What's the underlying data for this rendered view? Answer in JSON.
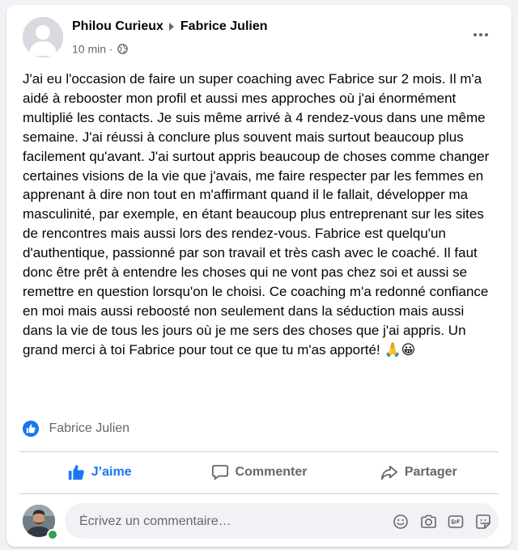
{
  "post": {
    "author": "Philou Curieux",
    "recipient": "Fabrice Julien",
    "time": "10 min",
    "separator": "·",
    "text": "J'ai eu l'occasion de faire un super coaching avec Fabrice sur 2 mois. Il m'a aidé à rebooster mon profil et aussi mes approches où j'ai énormément multiplié les contacts. Je suis même arrivé à 4 rendez-vous dans une même semaine. J'ai réussi à conclure plus souvent mais surtout beaucoup plus facilement qu'avant. J'ai surtout appris beaucoup de choses comme changer certaines visions de la vie que j'avais, me faire respecter par les femmes en apprenant à dire non tout en m'affirmant quand il le fallait, développer ma masculinité, par exemple, en étant beaucoup plus entreprenant sur les sites de rencontres mais aussi lors des rendez-vous. Fabrice est quelqu'un d'authentique, passionné par son travail et très cash avec le coaché. Il faut donc être prêt à entendre les choses qui ne vont pas chez soi et aussi se remettre en question lorsqu'on le choisi. Ce coaching m'a redonné confiance en moi mais aussi reboosté non seulement dans la séduction mais aussi dans la vie de tous les jours où je me sers des choses que j'ai appris. Un grand merci à toi Fabrice pour tout ce que tu m'as apporté!",
    "emojis": "🙏😀"
  },
  "reactions": {
    "name": "Fabrice Julien",
    "icon": "like-badge-icon"
  },
  "actions": {
    "like": "J’aime",
    "comment": "Commenter",
    "share": "Partager"
  },
  "comment_box": {
    "placeholder": "Écrivez un commentaire…"
  },
  "colors": {
    "accent": "#1877f2",
    "secondary_text": "#65676b",
    "online": "#31a24c"
  }
}
